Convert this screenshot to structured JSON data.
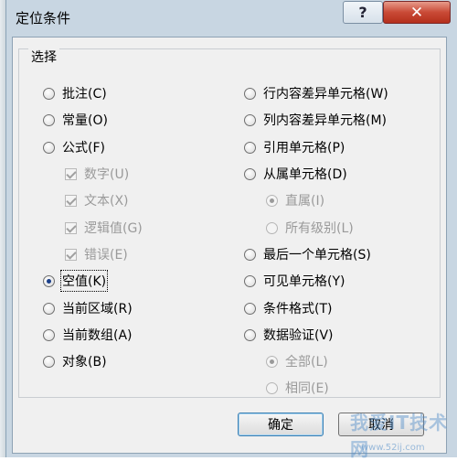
{
  "window": {
    "title": "定位条件",
    "help_label": "?",
    "close_label": "✕"
  },
  "group": {
    "label": "选择"
  },
  "left_options": [
    {
      "label": "批注(C)",
      "control": "radio",
      "checked": false,
      "disabled": false
    },
    {
      "label": "常量(O)",
      "control": "radio",
      "checked": false,
      "disabled": false
    },
    {
      "label": "公式(F)",
      "control": "radio",
      "checked": false,
      "disabled": false
    },
    {
      "label": "数字(U)",
      "control": "checkbox",
      "checked": true,
      "disabled": true
    },
    {
      "label": "文本(X)",
      "control": "checkbox",
      "checked": true,
      "disabled": true
    },
    {
      "label": "逻辑值(G)",
      "control": "checkbox",
      "checked": true,
      "disabled": true
    },
    {
      "label": "错误(E)",
      "control": "checkbox",
      "checked": true,
      "disabled": true
    },
    {
      "label": "空值(K)",
      "control": "radio",
      "checked": true,
      "disabled": false
    },
    {
      "label": "当前区域(R)",
      "control": "radio",
      "checked": false,
      "disabled": false
    },
    {
      "label": "当前数组(A)",
      "control": "radio",
      "checked": false,
      "disabled": false
    },
    {
      "label": "对象(B)",
      "control": "radio",
      "checked": false,
      "disabled": false
    }
  ],
  "right_options": [
    {
      "label": "行内容差异单元格(W)",
      "control": "radio",
      "checked": false,
      "disabled": false
    },
    {
      "label": "列内容差异单元格(M)",
      "control": "radio",
      "checked": false,
      "disabled": false
    },
    {
      "label": "引用单元格(P)",
      "control": "radio",
      "checked": false,
      "disabled": false
    },
    {
      "label": "从属单元格(D)",
      "control": "radio",
      "checked": false,
      "disabled": false
    },
    {
      "label": "直属(I)",
      "control": "radio",
      "checked": true,
      "disabled": true
    },
    {
      "label": "所有级别(L)",
      "control": "radio",
      "checked": false,
      "disabled": true
    },
    {
      "label": "最后一个单元格(S)",
      "control": "radio",
      "checked": false,
      "disabled": false
    },
    {
      "label": "可见单元格(Y)",
      "control": "radio",
      "checked": false,
      "disabled": false
    },
    {
      "label": "条件格式(T)",
      "control": "radio",
      "checked": false,
      "disabled": false
    },
    {
      "label": "数据验证(V)",
      "control": "radio",
      "checked": false,
      "disabled": false
    },
    {
      "label": "全部(L)",
      "control": "radio",
      "checked": true,
      "disabled": true
    },
    {
      "label": "相同(E)",
      "control": "radio",
      "checked": false,
      "disabled": true
    }
  ],
  "buttons": {
    "ok": "确定",
    "cancel": "取消"
  },
  "watermark": {
    "text": "我爱IT技术网",
    "url": "www.52ij.com"
  }
}
